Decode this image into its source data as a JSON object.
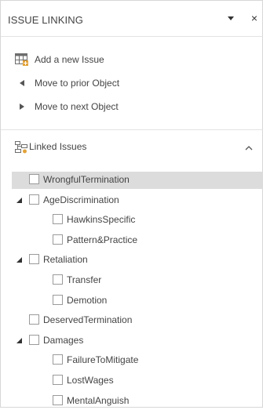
{
  "panel": {
    "title": "ISSUE LINKING",
    "close_glyph": "×"
  },
  "actions": [
    {
      "label": "Add a new Issue",
      "icon": "add-issue-table-icon"
    },
    {
      "label": "Move to prior Object",
      "icon": "arrow-left-icon"
    },
    {
      "label": "Move to next Object",
      "icon": "arrow-right-icon"
    }
  ],
  "linked_issues": {
    "header": "Linked Issues",
    "icon": "linked-issues-icon",
    "items": [
      {
        "label": "WrongfulTermination",
        "level": 0,
        "expandable": false,
        "checked": false,
        "selected": true
      },
      {
        "label": "AgeDiscrimination",
        "level": 0,
        "expandable": true,
        "checked": false,
        "selected": false
      },
      {
        "label": "HawkinsSpecific",
        "level": 1,
        "expandable": false,
        "checked": false,
        "selected": false
      },
      {
        "label": "Pattern&Practice",
        "level": 1,
        "expandable": false,
        "checked": false,
        "selected": false
      },
      {
        "label": "Retaliation",
        "level": 0,
        "expandable": true,
        "checked": false,
        "selected": false
      },
      {
        "label": "Transfer",
        "level": 1,
        "expandable": false,
        "checked": false,
        "selected": false
      },
      {
        "label": "Demotion",
        "level": 1,
        "expandable": false,
        "checked": false,
        "selected": false
      },
      {
        "label": "DeservedTermination",
        "level": 0,
        "expandable": false,
        "checked": false,
        "selected": false
      },
      {
        "label": "Damages",
        "level": 0,
        "expandable": true,
        "checked": false,
        "selected": false
      },
      {
        "label": "FailureToMitigate",
        "level": 1,
        "expandable": false,
        "checked": false,
        "selected": false
      },
      {
        "label": "LostWages",
        "level": 1,
        "expandable": false,
        "checked": false,
        "selected": false
      },
      {
        "label": "MentalAnguish",
        "level": 1,
        "expandable": false,
        "checked": false,
        "selected": false
      }
    ]
  },
  "colors": {
    "selected_row": "#dcdcdc",
    "checkbox_border": "#9a9a9a",
    "text": "#444444",
    "icon_accent": "#e2a33a"
  }
}
